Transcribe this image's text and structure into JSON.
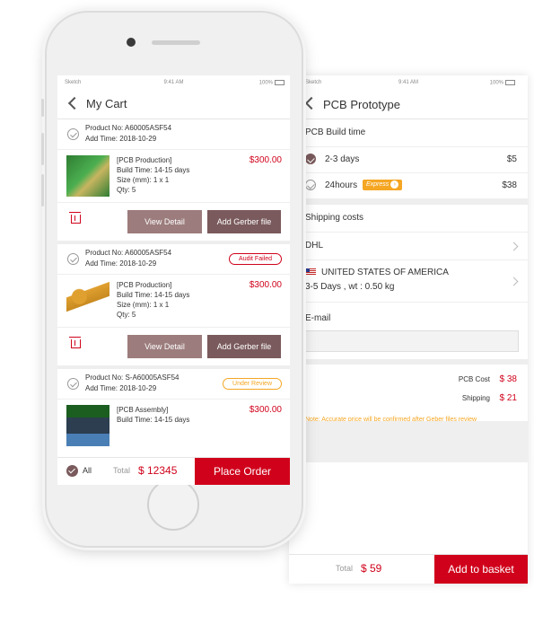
{
  "status_bar": {
    "carrier": "Sketch",
    "time": "9:41 AM",
    "battery": "100%"
  },
  "cart": {
    "title": "My Cart",
    "items": [
      {
        "product_no": "Product No: A60005ASF54",
        "add_time": "Add Time: 2018-10-29",
        "badge": "",
        "type": "[PCB Production]",
        "build_time": "Build Time: 14-15 days",
        "size": "Size (mm): 1 x 1",
        "qty": "Qty: 5",
        "price": "$300.00",
        "view_label": "View Detail",
        "gerber_label": "Add Gerber file"
      },
      {
        "product_no": "Product No: A60005ASF54",
        "add_time": "Add Time: 2018-10-29",
        "badge": "Audit Failed",
        "type": "[PCB Production]",
        "build_time": "Build Time: 14-15 days",
        "size": "Size (mm): 1 x 1",
        "qty": "Qty: 5",
        "price": "$300.00",
        "view_label": "View Detail",
        "gerber_label": "Add Gerber file"
      },
      {
        "product_no": "Product No: S-A60005ASF54",
        "add_time": "Add Time: 2018-10-29",
        "badge": "Under Review",
        "type": "[PCB Assembly]",
        "build_time": "Build Time: 14-15 days",
        "price": "$300.00"
      }
    ],
    "bottom": {
      "all_label": "All",
      "total_label": "Total",
      "total": "$ 12345",
      "order_label": "Place Order"
    }
  },
  "prototype": {
    "title": "PCB Prototype",
    "build_time_label": "PCB Build time",
    "options": [
      {
        "label": "2-3 days",
        "price": "$5",
        "selected": true
      },
      {
        "label": "24hours",
        "price": "$38",
        "selected": false,
        "tag": "Express"
      }
    ],
    "shipping_label": "Shipping costs",
    "carrier": "DHL",
    "country": "UNITED STATES OF AMERICA",
    "delivery": "3-5 Days ,  wt : 0.50 kg",
    "email_label": "E-mail",
    "pcb_cost_label": "PCB Cost",
    "pcb_cost": "$ 38",
    "shipping_cost_label": "Shipping",
    "shipping_cost": "$ 21",
    "note": "Note: Accurate price will be confirmed after Geber files review",
    "total_label": "Total",
    "total": "$ 59",
    "basket_label": "Add to basket"
  },
  "colors": {
    "accent": "#d0021b",
    "button_primary": "#7a5a5c",
    "button_secondary": "#9c7c7c",
    "warning": "#f5a623"
  }
}
